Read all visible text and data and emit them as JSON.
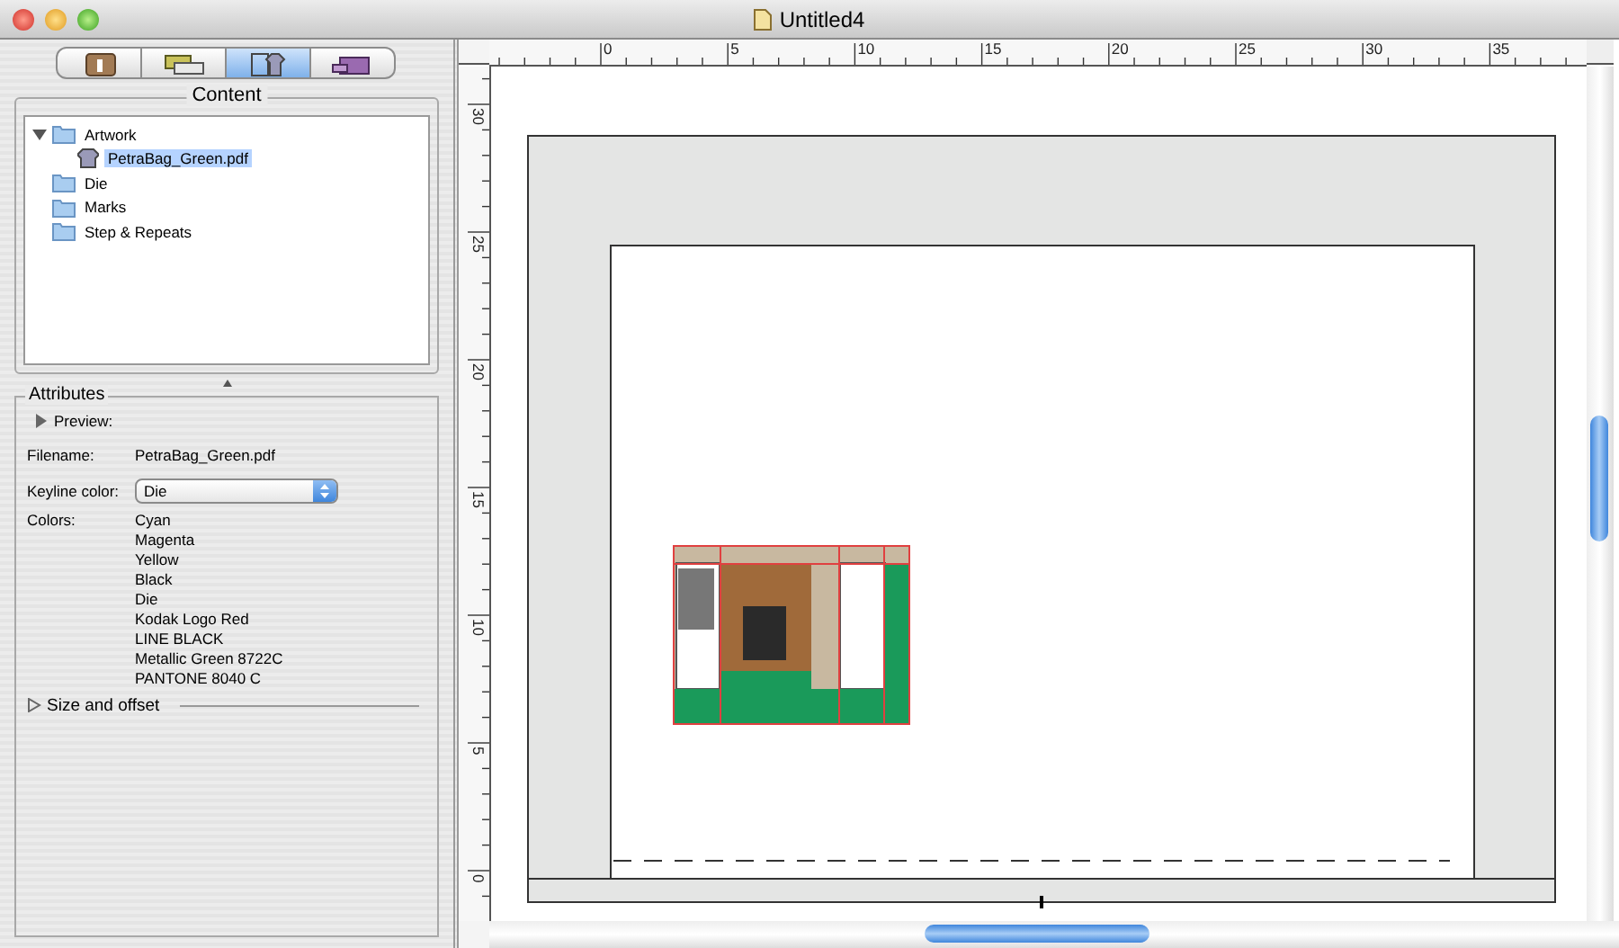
{
  "window": {
    "title": "Untitled4"
  },
  "panel_tabs": [
    {
      "selected": false
    },
    {
      "selected": false
    },
    {
      "selected": true
    },
    {
      "selected": false
    }
  ],
  "content": {
    "title": "Content",
    "tree": [
      {
        "label": "Artwork",
        "kind": "folder",
        "expanded": true,
        "selected": false,
        "children": [
          {
            "label": "PetraBag_Green.pdf",
            "selected": true,
            "kind": "file"
          }
        ]
      },
      {
        "label": "Die",
        "kind": "folder",
        "selected": false
      },
      {
        "label": "Marks",
        "kind": "folder",
        "selected": false
      },
      {
        "label": "Step & Repeats",
        "kind": "folder",
        "selected": false
      }
    ]
  },
  "attributes": {
    "title": "Attributes",
    "preview": {
      "label": "Preview:",
      "expanded": false
    },
    "filename": {
      "label": "Filename:",
      "value": "PetraBag_Green.pdf"
    },
    "keyline_color": {
      "label": "Keyline color:",
      "value": "Die"
    },
    "colors": {
      "label": "Colors:",
      "items": [
        "Cyan",
        "Magenta",
        "Yellow",
        "Black",
        "Die",
        "Kodak Logo Red",
        "LINE BLACK",
        "Metallic Green 8722C",
        "PANTONE 8040 C"
      ]
    },
    "size_and_offset": {
      "label": "Size and offset",
      "expanded": false
    }
  },
  "horizontal_ruler": {
    "labels": [
      "0",
      "5",
      "10",
      "15",
      "20",
      "25",
      "30",
      "35"
    ]
  },
  "vertical_ruler": {
    "labels": [
      "30",
      "25",
      "20",
      "15",
      "10",
      "5",
      "0"
    ]
  }
}
